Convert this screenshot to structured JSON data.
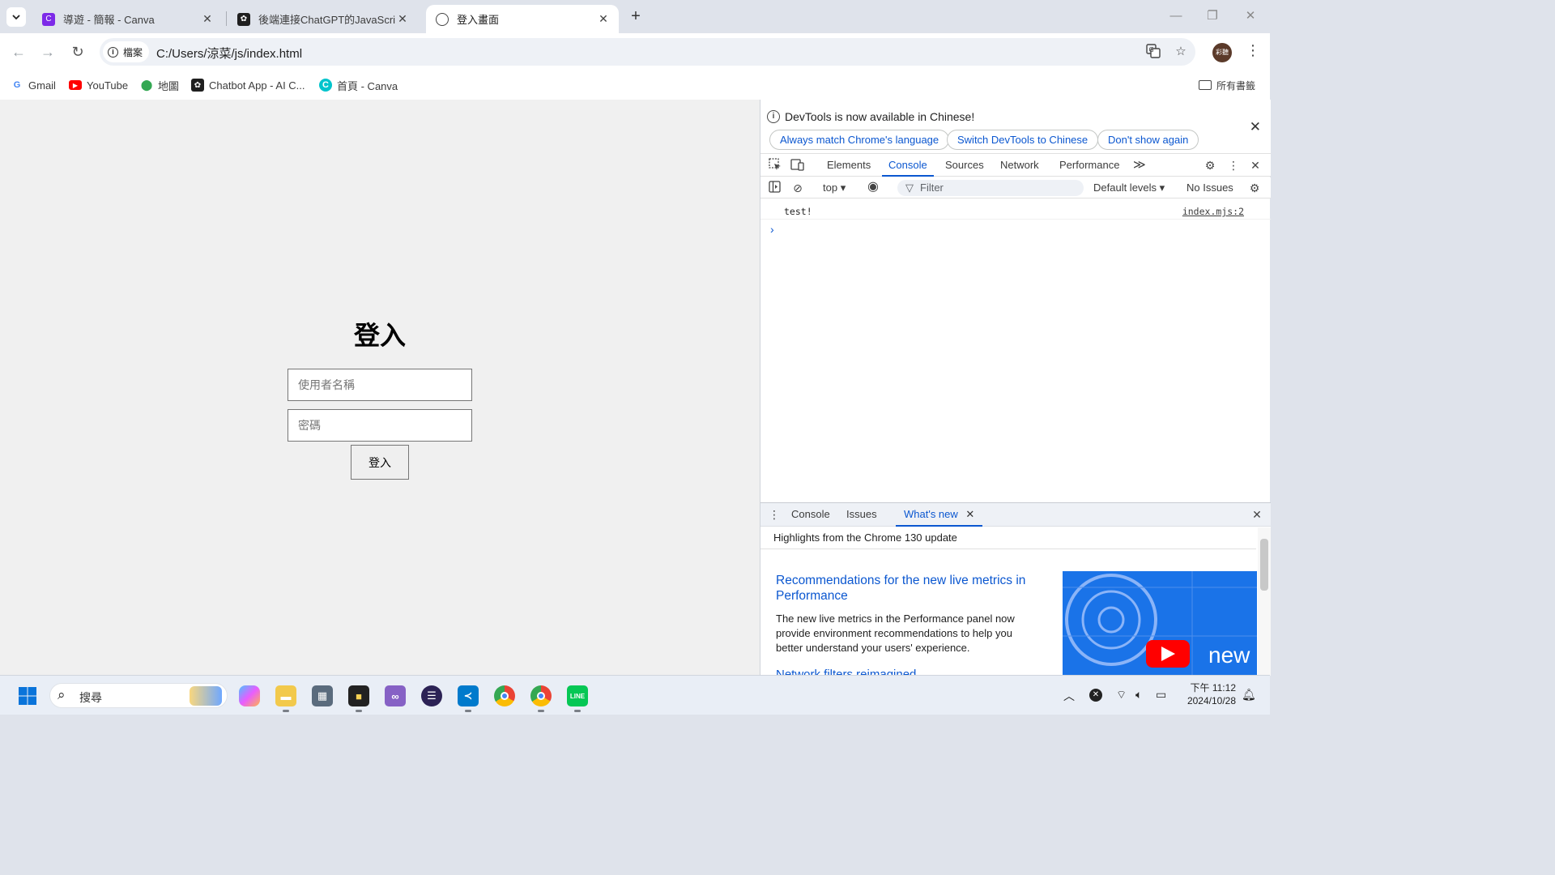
{
  "browser": {
    "tabs": [
      {
        "title": "導遊 - 簡報 - Canva",
        "favicon": "canva-icon",
        "active": false
      },
      {
        "title": "後端連接ChatGPT的JavaScript",
        "favicon": "chatgpt-icon",
        "active": false
      },
      {
        "title": "登入畫面",
        "favicon": "globe-icon",
        "active": true
      }
    ],
    "new_tab": "+",
    "window_controls": {
      "minimize": "—",
      "restore": "❐",
      "close": "✕"
    },
    "toolbar": {
      "back": "←",
      "forward": "→",
      "reload": "↻",
      "chip_label": "檔案",
      "url": "C:/Users/涼菜/js/index.html",
      "profile_label": "彩聽",
      "menu": "⋮"
    },
    "bookmarks": [
      {
        "label": "Gmail",
        "icon": "google-icon"
      },
      {
        "label": "YouTube",
        "icon": "youtube-icon"
      },
      {
        "label": "地圖",
        "icon": "maps-pin-icon"
      },
      {
        "label": "Chatbot App - AI C...",
        "icon": "chatbot-icon"
      },
      {
        "label": "首頁 - Canva",
        "icon": "canva-icon"
      }
    ],
    "all_bookmarks": "所有書籤"
  },
  "page": {
    "title": "登入",
    "username_placeholder": "使用者名稱",
    "password_placeholder": "密碼",
    "submit_label": "登入"
  },
  "devtools": {
    "infobar": {
      "message": "DevTools is now available in Chinese!",
      "buttons": [
        "Always match Chrome's language",
        "Switch DevTools to Chinese",
        "Don't show again"
      ]
    },
    "tabs": [
      "Elements",
      "Console",
      "Sources",
      "Network",
      "Performance"
    ],
    "active_tab": "Console",
    "more_tabs": "≫",
    "console_toolbar": {
      "context": "top",
      "filter_placeholder": "Filter",
      "levels": "Default levels",
      "issues": "No Issues"
    },
    "console_messages": [
      {
        "text": "test!",
        "source": "index.mjs:2"
      }
    ],
    "prompt": "›",
    "drawer": {
      "tabs": [
        "Console",
        "Issues",
        "What's new"
      ],
      "active_tab": "What's new",
      "heading": "Highlights from the Chrome 130 update",
      "article_title": "Recommendations for the new live metrics in Performance",
      "article_body": "The new live metrics in the Performance panel now provide environment recommendations to help you better understand your users' experience.",
      "next_title": "Network filters reimagined",
      "thumbnail_text": "new"
    }
  },
  "taskbar": {
    "search_label": "搜尋",
    "clock_time": "下午 11:12",
    "clock_date": "2024/10/28"
  },
  "colors": {
    "accent": "#0b57d0",
    "tabstrip": "#dfe3eb",
    "page_bg": "#f0f0f0"
  }
}
